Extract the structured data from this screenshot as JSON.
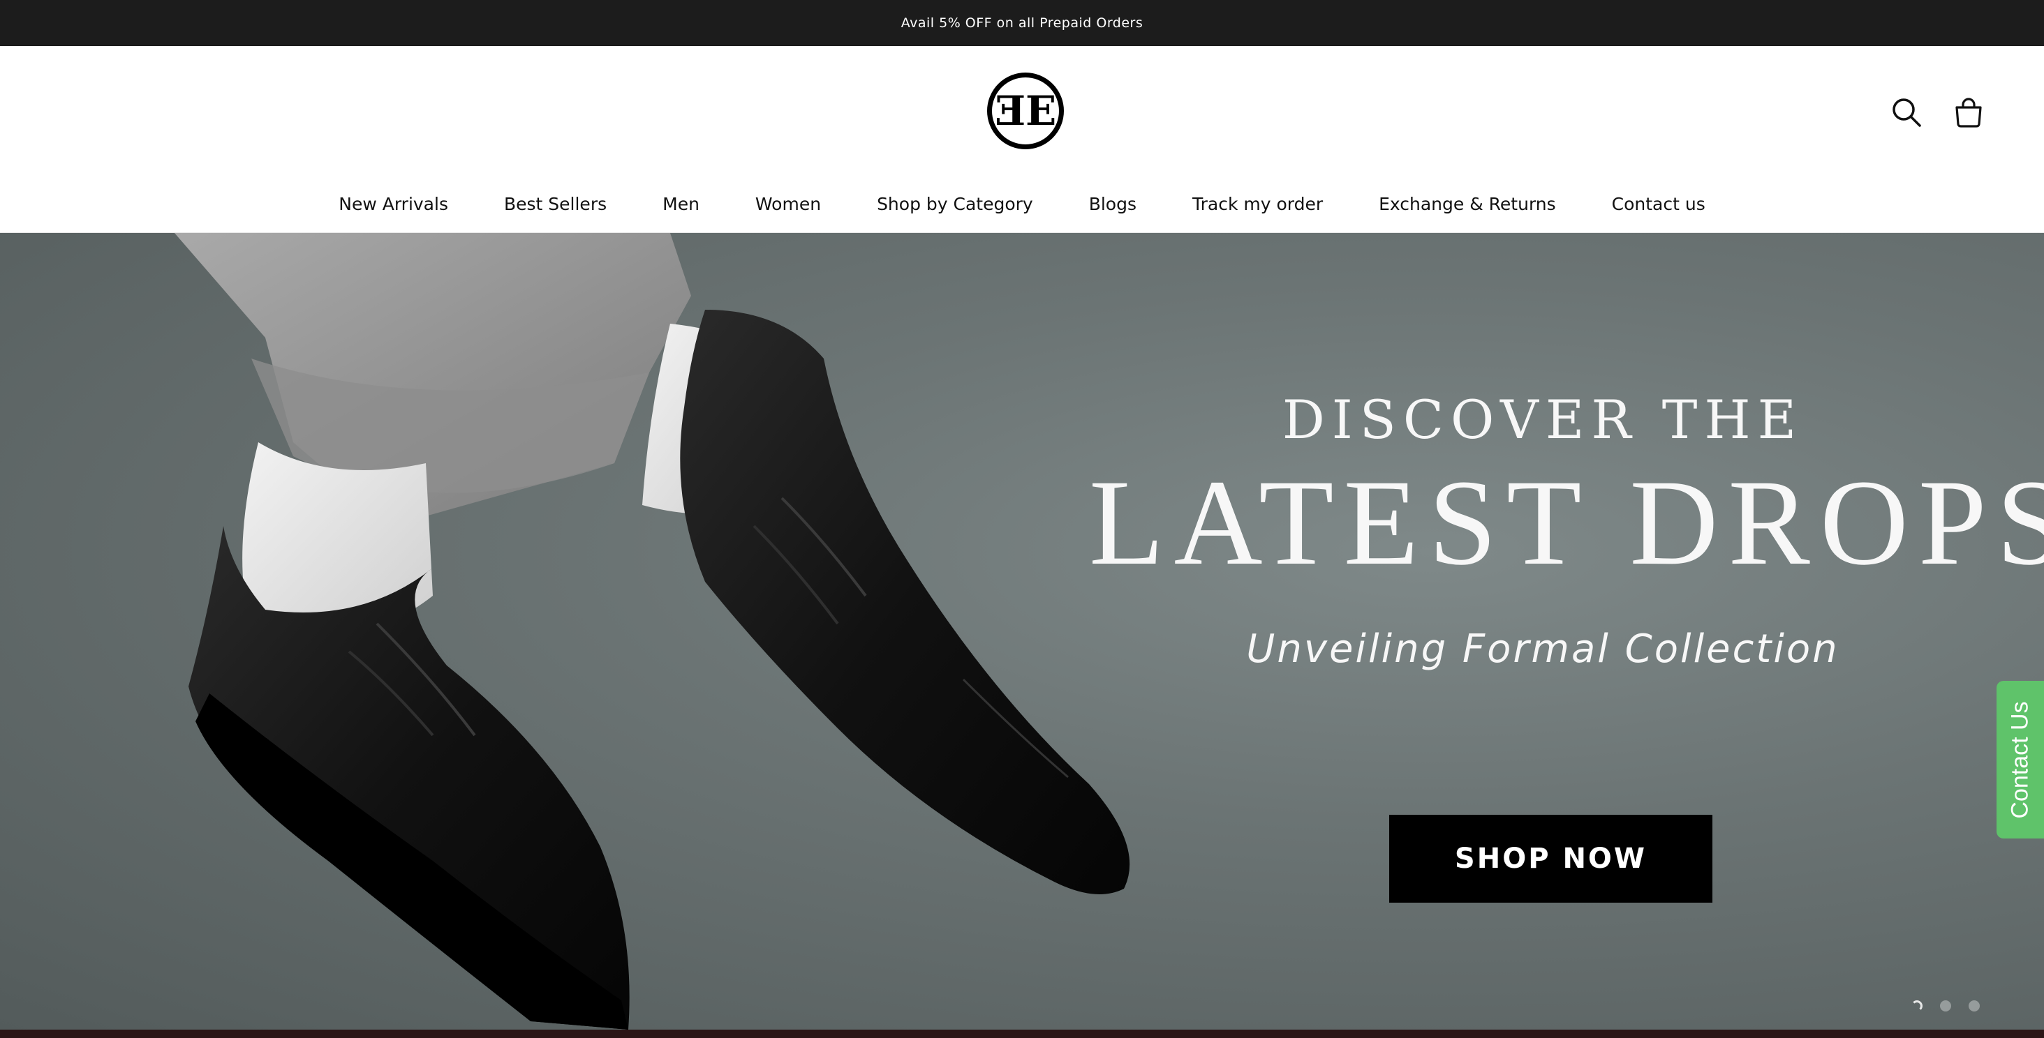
{
  "announcement": {
    "text": "Avail 5% OFF on all Prepaid Orders"
  },
  "header": {
    "logo_text": "EE",
    "icons": {
      "search": "search-icon",
      "cart": "shopping-bag-icon"
    }
  },
  "nav": {
    "items": [
      {
        "label": "New Arrivals"
      },
      {
        "label": "Best Sellers"
      },
      {
        "label": "Men"
      },
      {
        "label": "Women"
      },
      {
        "label": "Shop by Category"
      },
      {
        "label": "Blogs"
      },
      {
        "label": "Track my order"
      },
      {
        "label": "Exchange & Returns"
      },
      {
        "label": "Contact us"
      }
    ]
  },
  "hero": {
    "kicker": "DISCOVER THE",
    "title": "LATEST DROPS",
    "subtitle": "Unveiling Formal Collection",
    "cta_label": "SHOP NOW",
    "slides_total": 3,
    "active_slide": 1
  },
  "widget": {
    "contact_label": "Contact Us",
    "color": "#5fc36a"
  },
  "colors": {
    "announcement_bg": "#1c1c1c",
    "hero_bg": "#6b7474",
    "cta_bg": "#000000"
  }
}
